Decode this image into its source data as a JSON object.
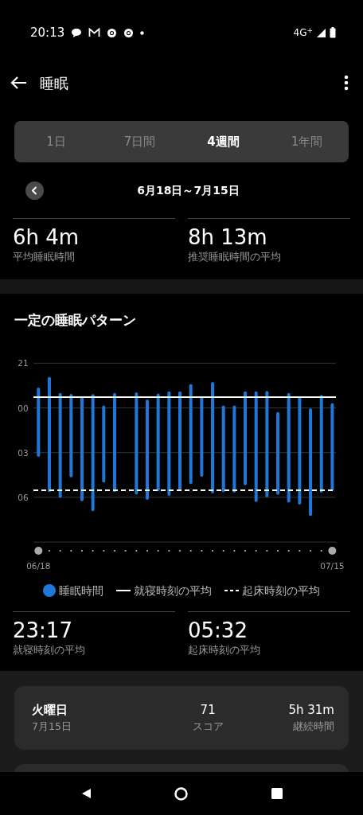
{
  "status_bar": {
    "time": "20:13",
    "network": "4G$^{+}$"
  },
  "header": {
    "title": "睡眠"
  },
  "period_tabs": [
    {
      "label": "1日",
      "selected": false
    },
    {
      "label": "7日間",
      "selected": false
    },
    {
      "label": "4週間",
      "selected": true
    },
    {
      "label": "1年間",
      "selected": false
    }
  ],
  "date_range": {
    "label": "6月18日～7月15日"
  },
  "summary": [
    {
      "value": "6h 4m",
      "label": "平均睡眠時間"
    },
    {
      "value": "8h 13m",
      "label": "推奨睡眠時間の平均"
    }
  ],
  "pattern": {
    "title": "一定の睡眠パターン",
    "y_axis_labels": [
      "21",
      "00",
      "03",
      "06"
    ],
    "x_axis_labels": [
      "06/18",
      "07/15"
    ],
    "legend": [
      {
        "kind": "dot",
        "label": "睡眠時間"
      },
      {
        "kind": "solid",
        "label": "就寝時刻の平均"
      },
      {
        "kind": "dashed",
        "label": "起床時刻の平均"
      }
    ],
    "stats": [
      {
        "value": "23:17",
        "label": "就寝時刻の平均"
      },
      {
        "value": "05:32",
        "label": "起床時刻の平均"
      }
    ]
  },
  "daily": [
    {
      "day": "火曜日",
      "date": "7月15日",
      "score": "71",
      "score_label": "スコア",
      "duration": "5h 31m",
      "duration_label": "継続時間"
    }
  ]
}
